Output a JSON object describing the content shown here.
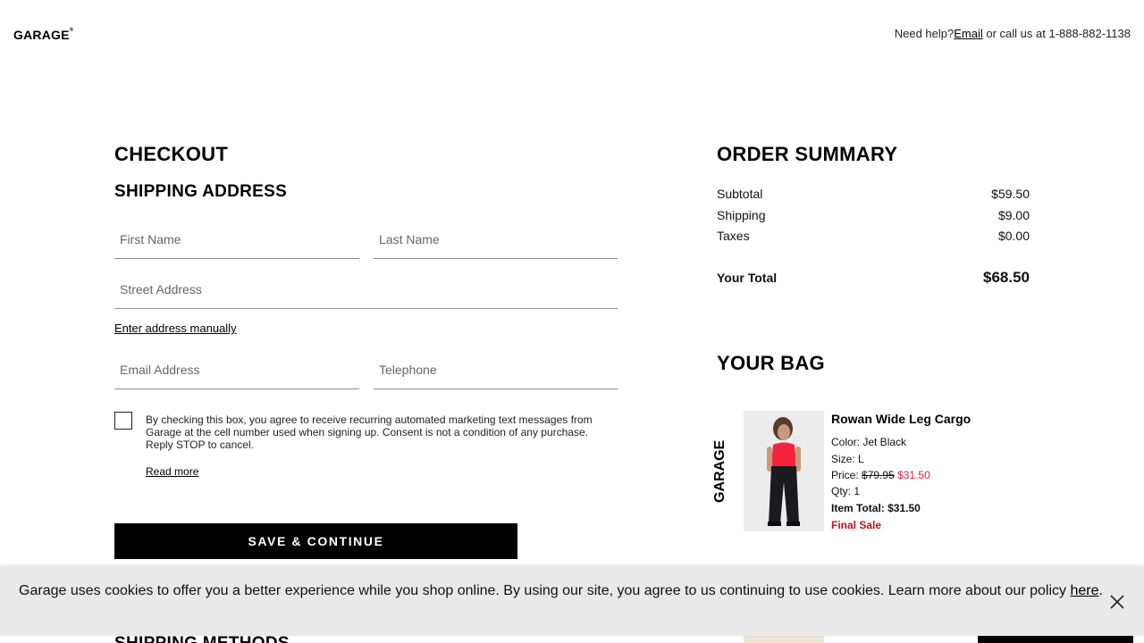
{
  "header": {
    "logo": "GARAGE",
    "help_prefix": "Need help?",
    "help_email_link": "Email",
    "help_suffix": " or call us at 1-888-882-1138"
  },
  "checkout": {
    "title": "CHECKOUT",
    "shipping_title": "SHIPPING ADDRESS",
    "first_name_placeholder": "First Name",
    "last_name_placeholder": "Last Name",
    "street_placeholder": "Street Address",
    "manual_link": "Enter address manually",
    "email_placeholder": "Email Address",
    "phone_placeholder": "Telephone",
    "consent_text": "By checking this box, you agree to receive recurring automated marketing text messages from Garage at the cell number used when signing up. Consent is not a condition of any purchase. Reply STOP to cancel.",
    "read_more": "Read more",
    "save_button": "SAVE & CONTINUE",
    "shipping_methods_title": "SHIPPING METHODS"
  },
  "summary": {
    "title": "ORDER SUMMARY",
    "subtotal_label": "Subtotal",
    "subtotal_value": "$59.50",
    "shipping_label": "Shipping",
    "shipping_value": "$9.00",
    "taxes_label": "Taxes",
    "taxes_value": "$0.00",
    "total_label": "Your Total",
    "total_value": "$68.50"
  },
  "bag": {
    "title": "YOUR BAG",
    "brand": "GARAGE",
    "item": {
      "name": "Rowan Wide Leg Cargo",
      "color": "Color: Jet Black",
      "size": "Size: L",
      "price_label": "Price: ",
      "original_price": "$79.95",
      "sale_price": "$31.50",
      "qty": "Qty: 1",
      "item_total": "Item Total: $31.50",
      "final_sale": "Final Sale"
    }
  },
  "cookie_banner": {
    "text": "Garage uses cookies to offer you a better experience while you shop online. By using our site, you agree to us continuing to use cookies. Learn more about our policy ",
    "link": "here",
    "suffix": "."
  },
  "colors": {
    "accent": "#000000",
    "sale": "#d8204a",
    "final_sale": "#c0121c",
    "cookie_bg": "#e9e9e9"
  }
}
